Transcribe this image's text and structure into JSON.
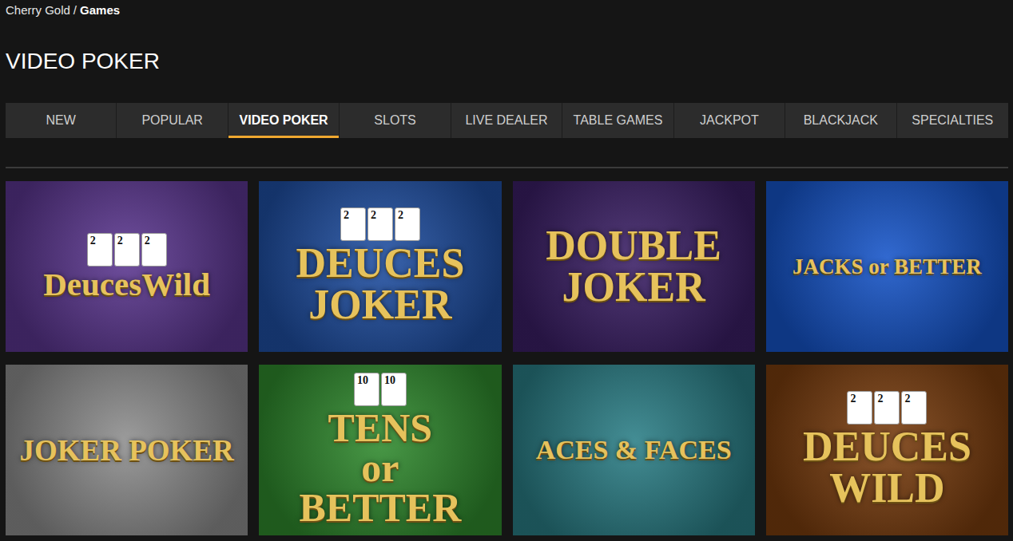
{
  "breadcrumb": {
    "site": "Cherry Gold",
    "separator": "/",
    "page": "Games"
  },
  "heading": "VIDEO POKER",
  "tabs": [
    {
      "label": "NEW",
      "selected": false
    },
    {
      "label": "POPULAR",
      "selected": false
    },
    {
      "label": "VIDEO POKER",
      "selected": true
    },
    {
      "label": "SLOTS",
      "selected": false
    },
    {
      "label": "LIVE DEALER",
      "selected": false
    },
    {
      "label": "TABLE GAMES",
      "selected": false
    },
    {
      "label": "JACKPOT",
      "selected": false
    },
    {
      "label": "BLACKJACK",
      "selected": false
    },
    {
      "label": "SPECIALTIES",
      "selected": false
    }
  ],
  "games": [
    {
      "title_lines": [
        "DeucesWild"
      ],
      "cards": [
        "2",
        "2",
        "2"
      ],
      "color": "#5b3690"
    },
    {
      "title_lines": [
        "DEUCES",
        "JOKER"
      ],
      "cards": [
        "2",
        "2",
        "2"
      ],
      "color": "#1f4fa3"
    },
    {
      "title_lines": [
        "DOUBLE",
        "JOKER"
      ],
      "cards": [],
      "color": "#3b1f66"
    },
    {
      "title_lines": [
        "JACKS or BETTER"
      ],
      "cards": [],
      "color": "#1554c9"
    },
    {
      "title_lines": [
        "JOKER POKER"
      ],
      "cards": [],
      "color": "#8e8e8e"
    },
    {
      "title_lines": [
        "TENS",
        "or",
        "BETTER"
      ],
      "cards": [
        "10",
        "10"
      ],
      "color": "#2f8a2d"
    },
    {
      "title_lines": [
        "ACES & FACES"
      ],
      "cards": [],
      "color": "#2a7e86"
    },
    {
      "title_lines": [
        "DEUCES",
        "WILD"
      ],
      "cards": [
        "2",
        "2",
        "2"
      ],
      "color": "#7a3d0e"
    }
  ]
}
